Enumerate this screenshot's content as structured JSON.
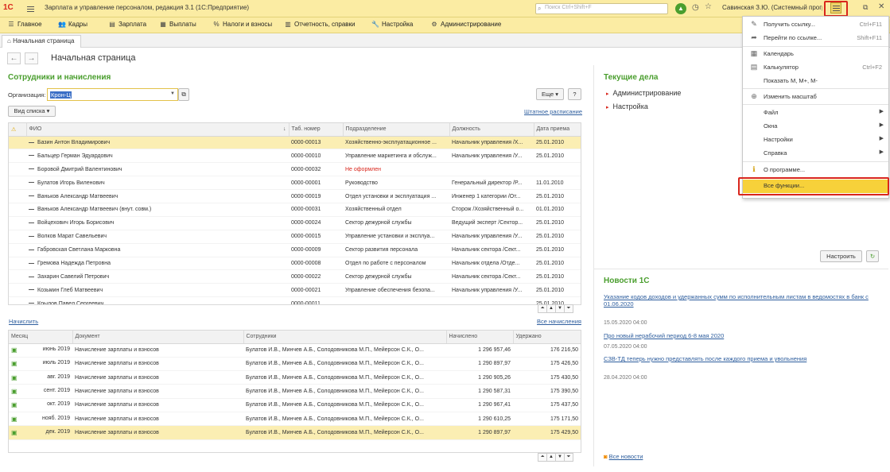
{
  "titlebar": {
    "logo": "1С",
    "title": "Зарплата и управление персоналом, редакция 3.1  (1С:Предприятие)",
    "search_placeholder": "Поиск Ctrl+Shift+F",
    "user": "Савинская З.Ю. (Системный программист)"
  },
  "menubar": [
    {
      "label": "Главное",
      "icon": "menu-icon"
    },
    {
      "label": "Кадры",
      "icon": "people-icon"
    },
    {
      "label": "Зарплата",
      "icon": "salary-icon"
    },
    {
      "label": "Выплаты",
      "icon": "payments-icon"
    },
    {
      "label": "Налоги и взносы",
      "icon": "percent-icon"
    },
    {
      "label": "Отчетность, справки",
      "icon": "reports-icon"
    },
    {
      "label": "Настройка",
      "icon": "wrench-icon"
    },
    {
      "label": "Администрирование",
      "icon": "gear-icon"
    }
  ],
  "tab": {
    "label": "Начальная страница"
  },
  "page_title": "Начальная страница",
  "employees": {
    "heading": "Сотрудники и начисления",
    "org_label": "Организация:",
    "org_value": "Крон-Ц",
    "more_button": "Еще",
    "help_button": "?",
    "view_button": "Вид списка",
    "staff_link": "Штатное расписание",
    "columns": [
      "ФИО",
      "Таб. номер",
      "Подразделение",
      "Должность",
      "Дата приема"
    ],
    "rows": [
      {
        "name": "Базин Антон Владимирович",
        "tab": "0000-00013",
        "dept": "Хозяйственно-эксплуатационное ...",
        "pos": "Начальник управления /Х...",
        "date": "25.01.2010",
        "selected": true
      },
      {
        "name": "Бальцер Герман Эдуардович",
        "tab": "0000-00010",
        "dept": "Управление маркетинга и обслуж...",
        "pos": "Начальник управления /У...",
        "date": "25.01.2010"
      },
      {
        "name": "Боровой Дмитрий Валентинович",
        "tab": "0000-00032",
        "dept": "Не оформлен",
        "pos": "",
        "date": "",
        "red": true
      },
      {
        "name": "Булатов Игорь Виленович",
        "tab": "0000-00001",
        "dept": "Руководство",
        "pos": "Генеральный директор /Р...",
        "date": "11.01.2010"
      },
      {
        "name": "Ваньков Александр Матвеевич",
        "tab": "0000-00019",
        "dept": "Отдел установки и эксплуатация ...",
        "pos": "Инженер 1 категории /От...",
        "date": "25.01.2010"
      },
      {
        "name": "Ваньков Александр Матвеевич (внут. совм.)",
        "tab": "0000-00031",
        "dept": "Хозяйственный отдел",
        "pos": "Сторож /Хозяйственный о...",
        "date": "01.01.2010"
      },
      {
        "name": "Войцехович Игорь Борисович",
        "tab": "0000-00024",
        "dept": "Сектор дежурной службы",
        "pos": "Ведущий эксперт /Сектор...",
        "date": "25.01.2010"
      },
      {
        "name": "Волков Марат Савельевич",
        "tab": "0000-00015",
        "dept": "Управление установки и эксплуа...",
        "pos": "Начальник управления /У...",
        "date": "25.01.2010"
      },
      {
        "name": "Габровская Светлана Марковна",
        "tab": "0000-00009",
        "dept": "Сектор развития персонала",
        "pos": "Начальник сектора /Сект...",
        "date": "25.01.2010"
      },
      {
        "name": "Гремова Надежда Петровна",
        "tab": "0000-00008",
        "dept": "Отдел по работе с персоналом",
        "pos": "Начальник отдела /Отде...",
        "date": "25.01.2010"
      },
      {
        "name": "Захарин Савелий Петрович",
        "tab": "0000-00022",
        "dept": "Сектор дежурной службы",
        "pos": "Начальник сектора /Сект...",
        "date": "25.01.2010"
      },
      {
        "name": "Козьмин Глеб Матвеевич",
        "tab": "0000-00021",
        "dept": "Управление обеспечения безопа...",
        "pos": "Начальник управления /У...",
        "date": "25.01.2010"
      },
      {
        "name": "Крылов Павел Сергеевич",
        "tab": "0000-00011",
        "dept": "",
        "pos": "",
        "date": "25.01.2010"
      }
    ]
  },
  "accruals": {
    "calc_link": "Начислить",
    "all_link": "Все начисления",
    "columns": [
      "Месяц",
      "Документ",
      "Сотрудники",
      "Начислено",
      "Удержано"
    ],
    "rows": [
      {
        "month": "июнь 2019",
        "doc": "Начисление зарплаты и взносов",
        "emps": "Булатов И.В., Минчев А.Б., Солодовникова М.П., Мейерсон С.К., О...",
        "accrued": "1 296 957,46",
        "withheld": "176 216,50"
      },
      {
        "month": "июль 2019",
        "doc": "Начисление зарплаты и взносов",
        "emps": "Булатов И.В., Минчев А.Б., Солодовникова М.П., Мейерсон С.К., О...",
        "accrued": "1 290 897,97",
        "withheld": "175 426,50"
      },
      {
        "month": "авг. 2019",
        "doc": "Начисление зарплаты и взносов",
        "emps": "Булатов И.В., Минчев А.Б., Солодовникова М.П., Мейерсон С.К., О...",
        "accrued": "1 290 905,26",
        "withheld": "175 430,50"
      },
      {
        "month": "сент. 2019",
        "doc": "Начисление зарплаты и взносов",
        "emps": "Булатов И.В., Минчев А.Б., Солодовникова М.П., Мейерсон С.К., О...",
        "accrued": "1 290 587,31",
        "withheld": "175 390,50"
      },
      {
        "month": "окт. 2019",
        "doc": "Начисление зарплаты и взносов",
        "emps": "Булатов И.В., Минчев А.Б., Солодовникова М.П., Мейерсон С.К., О...",
        "accrued": "1 290 967,41",
        "withheld": "175 437,50"
      },
      {
        "month": "нояб. 2019",
        "doc": "Начисление зарплаты и взносов",
        "emps": "Булатов И.В., Минчев А.Б., Солодовникова М.П., Мейерсон С.К., О...",
        "accrued": "1 290 610,25",
        "withheld": "175 171,50"
      },
      {
        "month": "дек. 2019",
        "doc": "Начисление зарплаты и взносов",
        "emps": "Булатов И.В., Минчев А.Б., Солодовникова М.П., Мейерсон С.К., О...",
        "accrued": "1 290 897,97",
        "withheld": "175 429,50",
        "selected": true
      }
    ]
  },
  "tasks": {
    "heading": "Текущие дела",
    "items": [
      "Администрирование",
      "Настройка"
    ],
    "configure_button": "Настроить"
  },
  "news": {
    "heading": "Новости 1С",
    "items": [
      {
        "title": "Указание кодов доходов и удержанных сумм по исполнительным листам в ведомостях в банк с 01.06.2020",
        "date": "15.05.2020 04:00"
      },
      {
        "title": "Про новый нерабочий период 6-8 мая 2020",
        "date": "07.05.2020 04:00"
      },
      {
        "title": "СЗВ-ТД теперь нужно представлять после каждого приема и увольнения",
        "date": "28.04.2020 04:00"
      }
    ],
    "all_link": "Все новости"
  },
  "menu": {
    "items": [
      {
        "label": "Получить ссылку...",
        "shortcut": "Ctrl+F11",
        "icon": "link-icon"
      },
      {
        "label": "Перейти по ссылке...",
        "shortcut": "Shift+F11",
        "icon": "follow-link-icon"
      },
      {
        "label": "Календарь",
        "shortcut": "",
        "icon": "calendar-icon"
      },
      {
        "label": "Калькулятор",
        "shortcut": "Ctrl+F2",
        "icon": "calculator-icon"
      },
      {
        "label": "Показать М, М+, М-",
        "shortcut": "",
        "icon": ""
      },
      {
        "label": "Изменить масштаб",
        "shortcut": "",
        "icon": "zoom-icon"
      },
      {
        "label": "Файл",
        "shortcut": "",
        "icon": "",
        "submenu": true
      },
      {
        "label": "Окна",
        "shortcut": "",
        "icon": "",
        "submenu": true
      },
      {
        "label": "Настройки",
        "shortcut": "",
        "icon": "",
        "submenu": true
      },
      {
        "label": "Справка",
        "shortcut": "",
        "icon": "",
        "submenu": true
      },
      {
        "label": "О программе...",
        "shortcut": "",
        "icon": "info-icon"
      },
      {
        "label": "Все функции...",
        "shortcut": "",
        "icon": "",
        "highlighted": true
      }
    ]
  },
  "colors": {
    "accent_yellow": "#fbeca3",
    "heading_green": "#4a9e2e",
    "highlight_red": "#d9261c",
    "link_blue": "#2e5e9e"
  }
}
